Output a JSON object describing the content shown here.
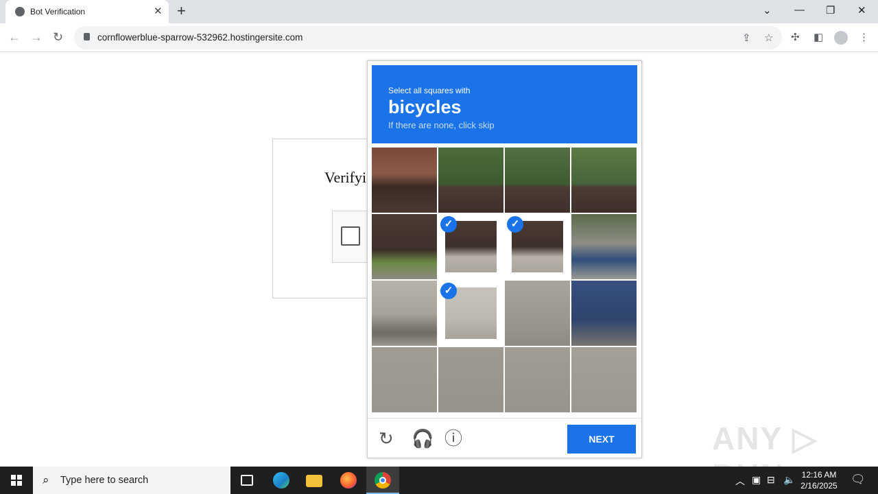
{
  "browser": {
    "tab_title": "Bot Verification",
    "url": "cornflowerblue-sparrow-532962.hostingersite.com"
  },
  "page": {
    "title_partial": "Verifyi"
  },
  "captcha": {
    "instruction": "Select all squares with",
    "target": "bicycles",
    "hint": "If there are none, click skip",
    "next_label": "NEXT",
    "selected_tiles": [
      5,
      6,
      9
    ],
    "accent_color": "#1a73e8"
  },
  "taskbar": {
    "search_placeholder": "Type here to search",
    "time": "12:16 AM",
    "date": "2/16/2025"
  },
  "watermark": "ANY RUN"
}
